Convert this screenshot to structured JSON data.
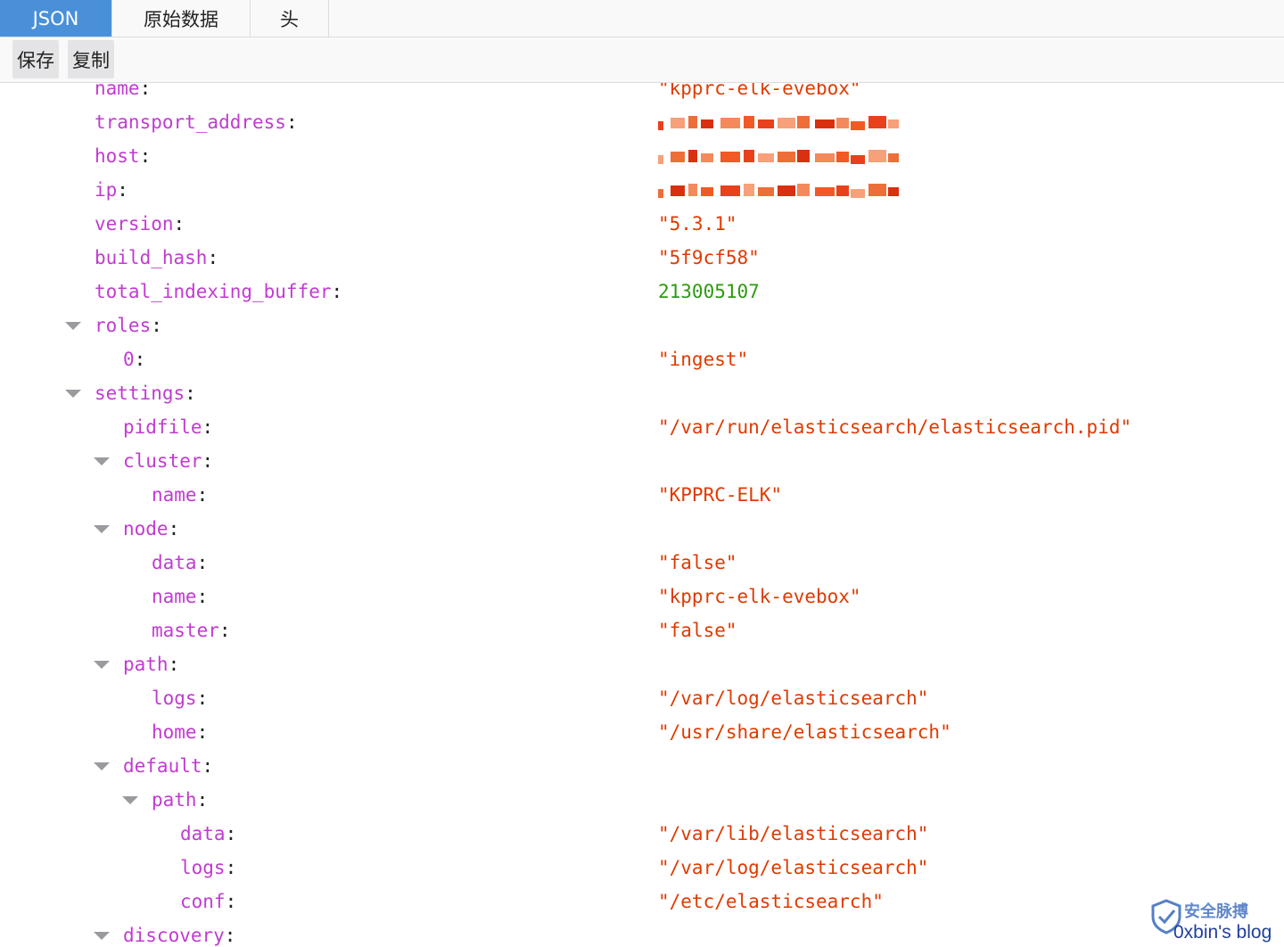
{
  "tabs": [
    {
      "label": "JSON",
      "active": true
    },
    {
      "label": "原始数据",
      "active": false
    },
    {
      "label": "头",
      "active": false
    }
  ],
  "toolbar": {
    "save": "保存",
    "copy": "复制"
  },
  "colors": {
    "key": "#c13bd1",
    "string": "#e03a00",
    "number": "#2e9a11",
    "tab_active": "#4a90d9"
  },
  "rows": [
    {
      "key": "name",
      "value": "\"kpprc-elk-evebox\"",
      "type": "string"
    },
    {
      "key": "transport_address",
      "value": "",
      "type": "redacted"
    },
    {
      "key": "host",
      "value": "",
      "type": "redacted"
    },
    {
      "key": "ip",
      "value": "",
      "type": "redacted"
    },
    {
      "key": "version",
      "value": "\"5.3.1\"",
      "type": "string"
    },
    {
      "key": "build_hash",
      "value": "\"5f9cf58\"",
      "type": "string"
    },
    {
      "key": "total_indexing_buffer",
      "value": "213005107",
      "type": "number"
    },
    {
      "key": "roles",
      "value": "",
      "type": "object",
      "expanded": true
    },
    {
      "key": "0",
      "value": "\"ingest\"",
      "type": "string"
    },
    {
      "key": "settings",
      "value": "",
      "type": "object",
      "expanded": true
    },
    {
      "key": "pidfile",
      "value": "\"/var/run/elasticsearch/elasticsearch.pid\"",
      "type": "string"
    },
    {
      "key": "cluster",
      "value": "",
      "type": "object",
      "expanded": true
    },
    {
      "key": "name",
      "value": "\"KPPRC-ELK\"",
      "type": "string"
    },
    {
      "key": "node",
      "value": "",
      "type": "object",
      "expanded": true
    },
    {
      "key": "data",
      "value": "\"false\"",
      "type": "string"
    },
    {
      "key": "name",
      "value": "\"kpprc-elk-evebox\"",
      "type": "string"
    },
    {
      "key": "master",
      "value": "\"false\"",
      "type": "string"
    },
    {
      "key": "path",
      "value": "",
      "type": "object",
      "expanded": true
    },
    {
      "key": "logs",
      "value": "\"/var/log/elasticsearch\"",
      "type": "string"
    },
    {
      "key": "home",
      "value": "\"/usr/share/elasticsearch\"",
      "type": "string"
    },
    {
      "key": "default",
      "value": "",
      "type": "object",
      "expanded": true
    },
    {
      "key": "path",
      "value": "",
      "type": "object",
      "expanded": true
    },
    {
      "key": "data",
      "value": "\"/var/lib/elasticsearch\"",
      "type": "string"
    },
    {
      "key": "logs",
      "value": "\"/var/log/elasticsearch\"",
      "type": "string"
    },
    {
      "key": "conf",
      "value": "\"/etc/elasticsearch\"",
      "type": "string"
    },
    {
      "key": "discovery",
      "value": "",
      "type": "object",
      "expanded": true
    }
  ],
  "watermark": {
    "brand": "安全脉搏",
    "blog": "0xbin's blog"
  }
}
